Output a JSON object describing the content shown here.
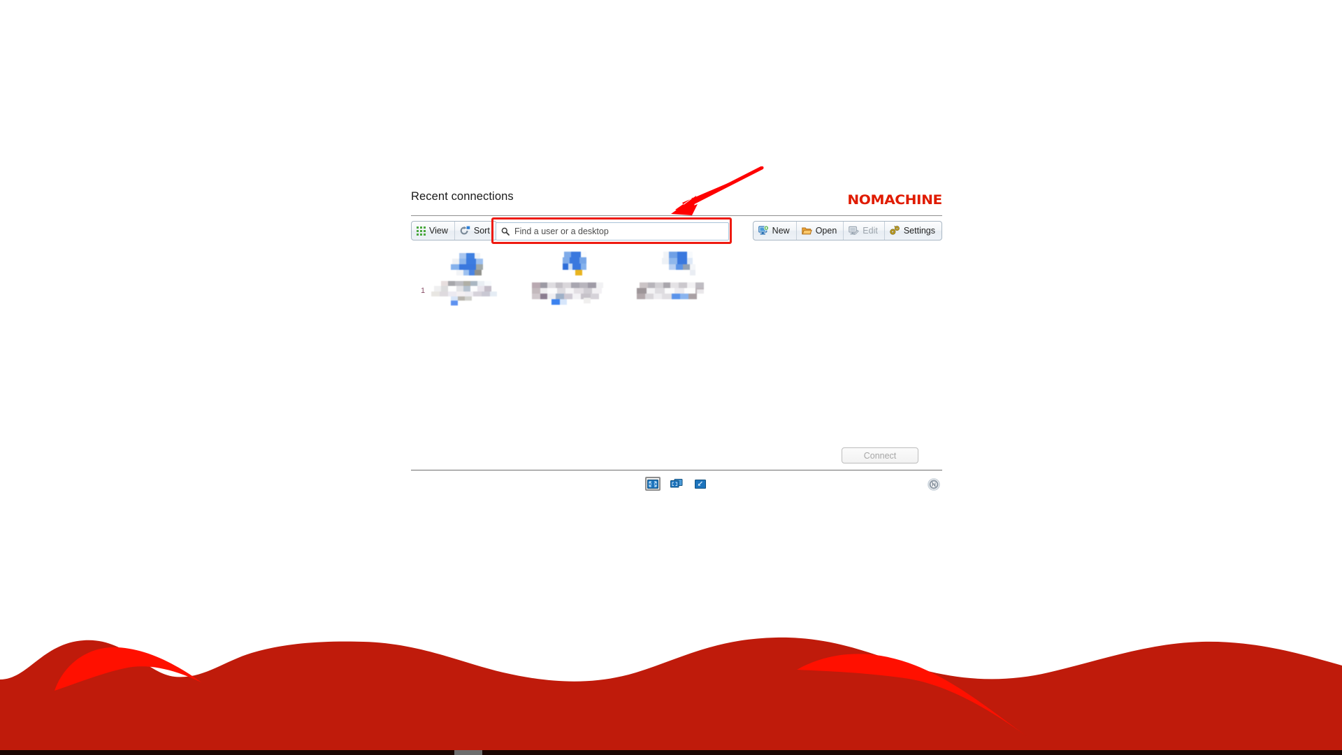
{
  "window": {
    "background_color": "#ffffff",
    "wave_color": "#bf1b0b",
    "wave_highlight_color": "#ff1000",
    "bottom_bar_color": "#1a0400"
  },
  "header": {
    "title": "Recent connections",
    "brand": "NOMACHINE",
    "brand_color": "#e01b00"
  },
  "toolbar": {
    "left_buttons": [
      {
        "label": "View",
        "icon": "grid-icon",
        "disabled": false
      },
      {
        "label": "Sort",
        "icon": "sort-icon",
        "disabled": false
      }
    ],
    "right_buttons": [
      {
        "label": "New",
        "icon": "new-connection-icon",
        "disabled": false
      },
      {
        "label": "Open",
        "icon": "folder-open-icon",
        "disabled": false
      },
      {
        "label": "Edit",
        "icon": "edit-icon",
        "disabled": true
      },
      {
        "label": "Settings",
        "icon": "gears-icon",
        "disabled": false
      }
    ]
  },
  "search": {
    "placeholder": "Find a user or a desktop",
    "value": "",
    "icon": "search-icon",
    "highlight_color": "#ee1b11",
    "highlighted": true
  },
  "annotation": {
    "type": "arrow",
    "color": "#fe0000",
    "points_to": "search-input"
  },
  "connections": [
    {
      "index": "1",
      "name_redacted": true
    },
    {
      "index": "",
      "name_redacted": true
    },
    {
      "index": "",
      "name_redacted": true
    }
  ],
  "footer": {
    "connect_label": "Connect",
    "connect_disabled": true,
    "view_modes": [
      {
        "icon": "fullscreen-icon",
        "selected": true
      },
      {
        "icon": "multi-monitor-icon",
        "selected": false
      },
      {
        "icon": "scale-window-icon",
        "selected": false
      }
    ],
    "help_icon": "nomachine-help-icon"
  }
}
